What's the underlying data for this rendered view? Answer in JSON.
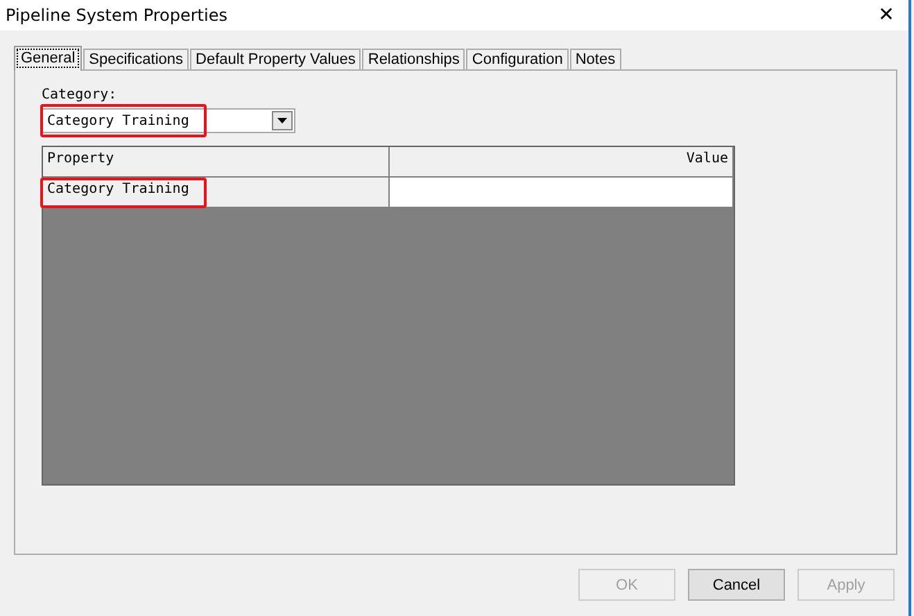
{
  "window": {
    "title": "Pipeline System Properties",
    "close": "✕"
  },
  "tabs": [
    {
      "label": "General",
      "selected": true
    },
    {
      "label": "Specifications",
      "selected": false
    },
    {
      "label": "Default Property Values",
      "selected": false
    },
    {
      "label": "Relationships",
      "selected": false
    },
    {
      "label": "Configuration",
      "selected": false
    },
    {
      "label": "Notes",
      "selected": false
    }
  ],
  "category": {
    "label": "Category:",
    "value": "Category Training",
    "highlighted": true
  },
  "grid": {
    "columns": [
      "Property",
      "Value"
    ],
    "rows": [
      {
        "property": "Category Training",
        "value": "",
        "highlighted": true
      }
    ]
  },
  "buttons": [
    {
      "label": "OK",
      "disabled": true
    },
    {
      "label": "Cancel",
      "disabled": false
    },
    {
      "label": "Apply",
      "disabled": true
    }
  ]
}
